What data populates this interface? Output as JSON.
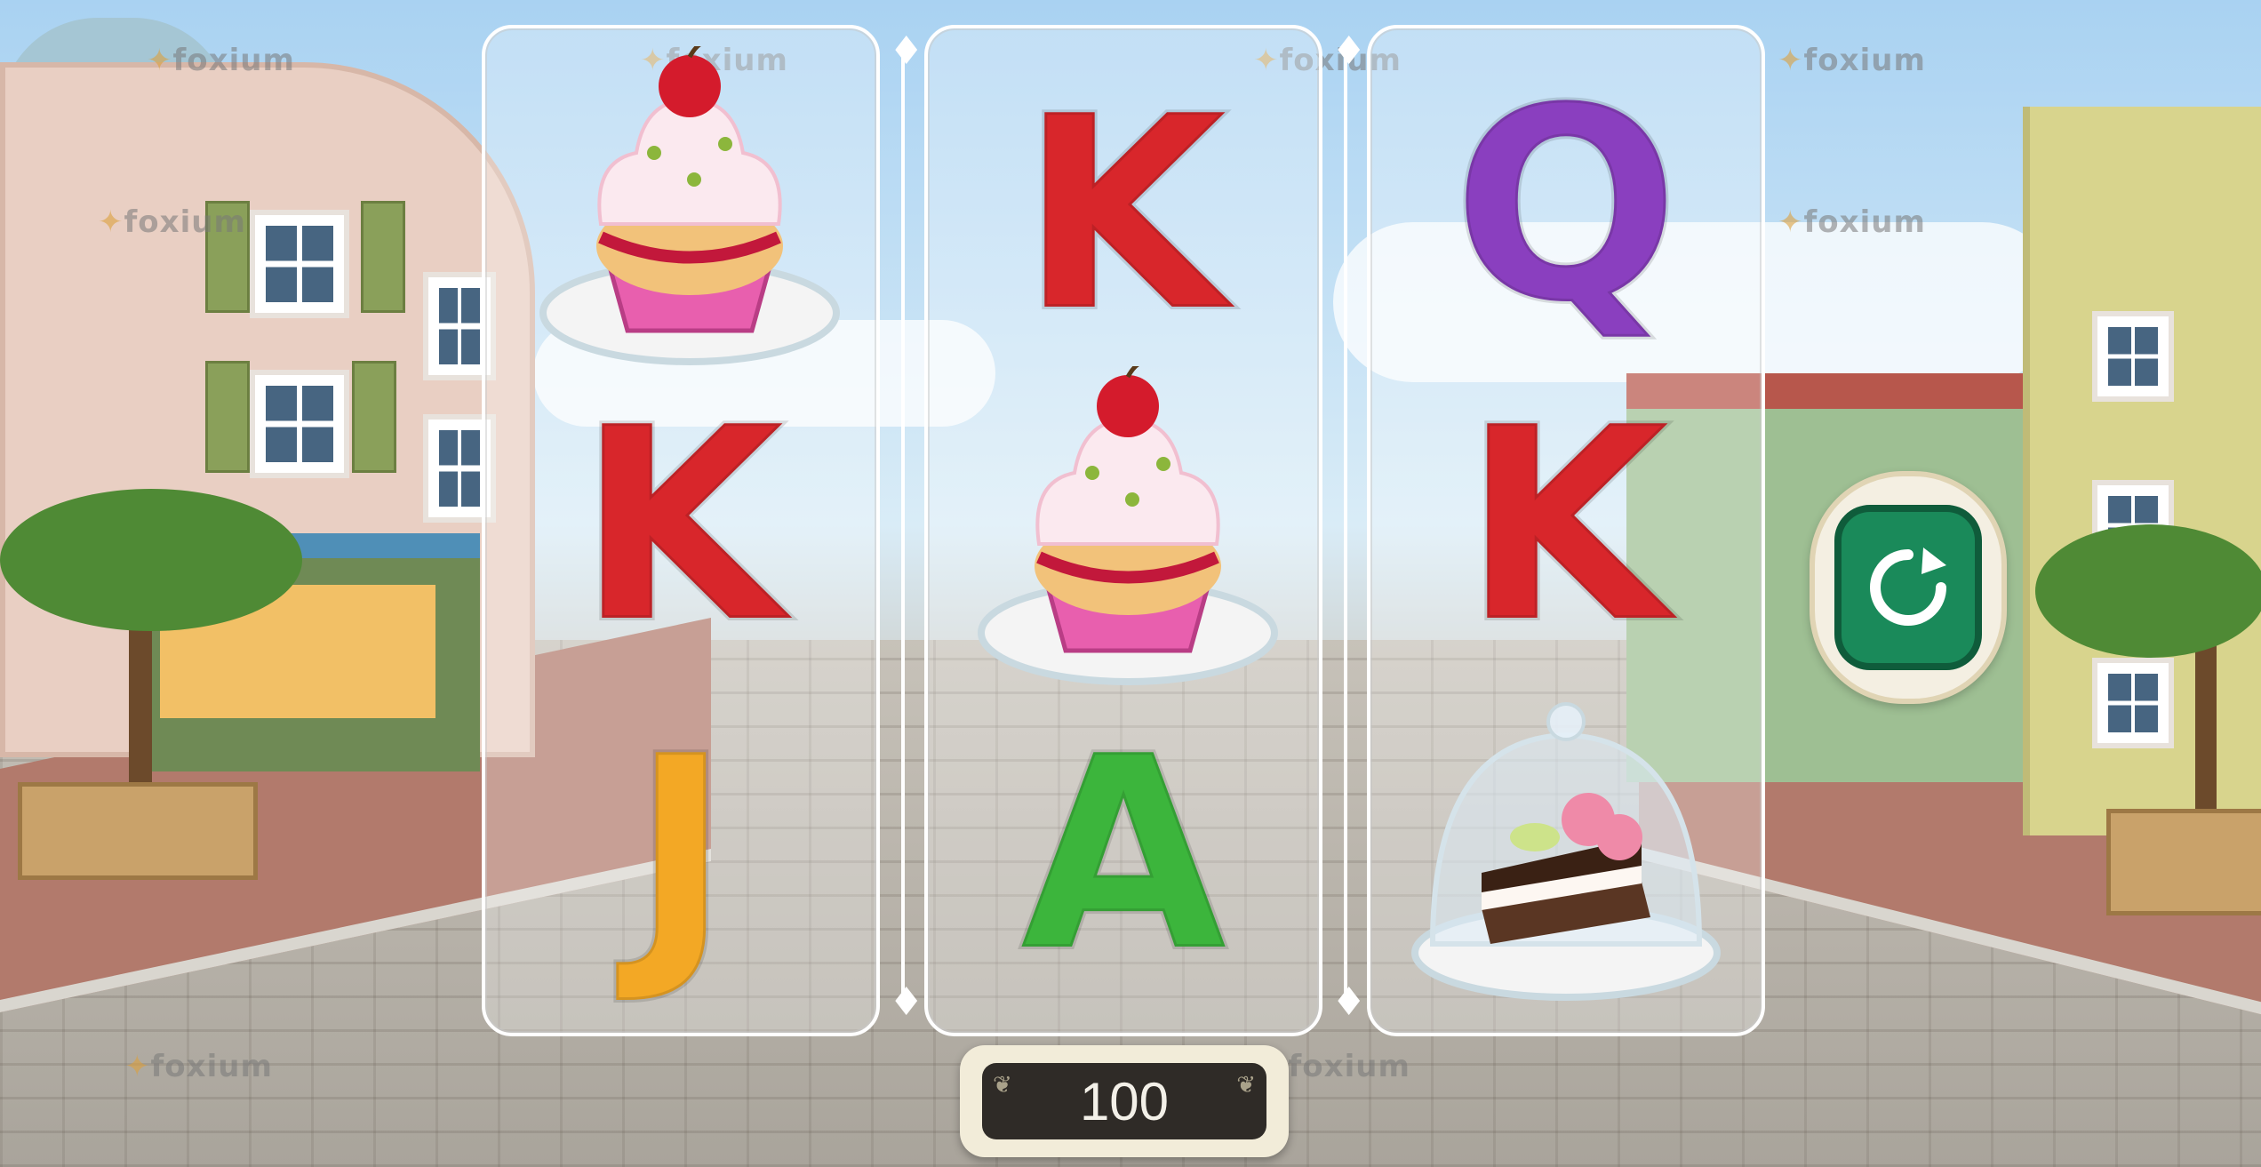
{
  "game": {
    "watermark_text": "foxium",
    "watermark_tm": "™",
    "bet_value": "100",
    "spin_icon": "refresh-arrow-icon"
  },
  "reels": [
    {
      "symbols": [
        "cupcake",
        "K",
        "J"
      ]
    },
    {
      "symbols": [
        "K",
        "cupcake",
        "A"
      ]
    },
    {
      "symbols": [
        "Q",
        "K",
        "cake-under-dome"
      ]
    }
  ],
  "colors": {
    "K": "#d8262b",
    "Q": "#8a3fbf",
    "J": "#f3a825",
    "A": "#3cb53c",
    "spin_button": "#1a8a5a"
  }
}
